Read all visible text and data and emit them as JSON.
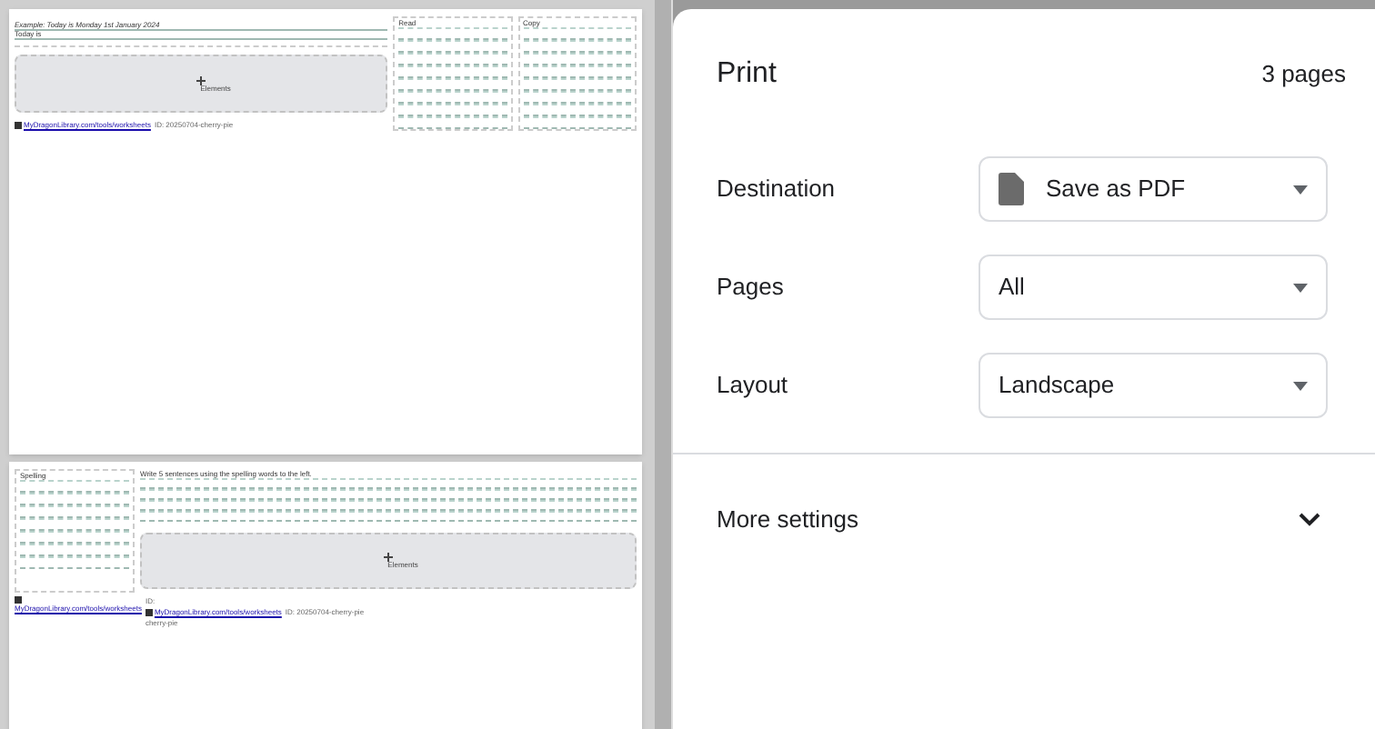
{
  "preview": {
    "pages": [
      {
        "kind": "practice",
        "example": "Example: Today is Monday 1st January 2024",
        "prompt": "Today is",
        "elements": "Elements",
        "columns": [
          "Read",
          "Copy"
        ],
        "footer_link": "MyDragonLibrary.com/tools/worksheets",
        "footer_id": "ID: 20250704-cherry-pie"
      },
      {
        "kind": "sentences",
        "heading": "Spelling",
        "instruction": "Write 5 sentences using the spelling words to the left.",
        "elements": "Elements",
        "footer_link": "MyDragonLibrary.com/tools/worksheets",
        "footer_id_label": "ID:",
        "footer_link_2": "MyDragonLibrary.com/tools/worksheets",
        "footer_id": "ID: 20250704-cherry-pie",
        "footer_tail": "cherry-pie"
      }
    ]
  },
  "print": {
    "title": "Print",
    "page_count": "3 pages",
    "settings": [
      {
        "kind": "destination",
        "label": "Destination",
        "value": "Save as PDF"
      },
      {
        "kind": "select",
        "label": "Pages",
        "value": "All"
      },
      {
        "kind": "select",
        "label": "Layout",
        "value": "Landscape"
      }
    ],
    "more_settings": {
      "label": "More settings",
      "expanded": false
    }
  }
}
